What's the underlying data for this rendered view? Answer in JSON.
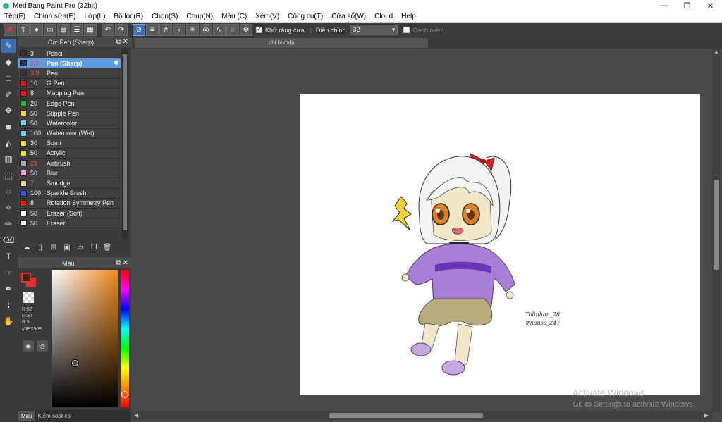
{
  "window": {
    "title": "MediBang Paint Pro (32bit)",
    "minimize": "—",
    "maximize": "❐",
    "close": "✕"
  },
  "menu": [
    "Tệp(F)",
    "Chỉnh sửa(E)",
    "Lớp(L)",
    "Bộ lọc(R)",
    "Chọn(S)",
    "Chụp(N)",
    "Màu (C)",
    "Xem(V)",
    "Công cụ(T)",
    "Cửa sổ(W)",
    "Cloud",
    "Help"
  ],
  "toolbar": {
    "antialias_label": "Khử răng cưa",
    "adjust_label": "Điều chỉnh",
    "adjust_value": "32",
    "edge_label": "Cạnh mềm"
  },
  "brush_panel": {
    "title": "Cọ: Pen (Sharp)",
    "brushes": [
      {
        "size": "3",
        "name": "Pencil",
        "color": "#333333",
        "size_red": false
      },
      {
        "size": "2.7",
        "name": "Pen (Sharp)",
        "color": "#333333",
        "size_red": true,
        "selected": true
      },
      {
        "size": "3.9",
        "name": "Pen",
        "color": "#333333",
        "size_red": true
      },
      {
        "size": "10",
        "name": "G Pen",
        "color": "#e02020",
        "size_red": false
      },
      {
        "size": "8",
        "name": "Mapping Pen",
        "color": "#e02020",
        "size_red": false
      },
      {
        "size": "20",
        "name": "Edge Pen",
        "color": "#2ab52a",
        "size_red": false
      },
      {
        "size": "50",
        "name": "Stipple Pen",
        "color": "#f0e020",
        "size_red": false
      },
      {
        "size": "50",
        "name": "Watercolor",
        "color": "#80d0f0",
        "size_red": false
      },
      {
        "size": "100",
        "name": "Watercolor (Wet)",
        "color": "#80d0f0",
        "size_red": false
      },
      {
        "size": "30",
        "name": "Sumi",
        "color": "#f0e020",
        "size_red": false
      },
      {
        "size": "50",
        "name": "Acrylic",
        "color": "#f0e020",
        "size_red": false
      },
      {
        "size": "29",
        "name": "Airbrush",
        "color": "#aaaaaa",
        "size_red": true
      },
      {
        "size": "50",
        "name": "Blur",
        "color": "#f0a0e0",
        "size_red": false
      },
      {
        "size": "7",
        "name": "Smudge",
        "color": "#f0d0b0",
        "size_red": true
      },
      {
        "size": "100",
        "name": "Sparkle Brush",
        "color": "#3050e0",
        "size_red": false
      },
      {
        "size": "8",
        "name": "Rotation Symmetry Pen",
        "color": "#e02020",
        "size_red": false
      },
      {
        "size": "50",
        "name": "Eraser (Soft)",
        "color": "#ffffff",
        "size_red": false
      },
      {
        "size": "50",
        "name": "Eraser",
        "color": "#ffffff",
        "size_red": false
      }
    ]
  },
  "color_panel": {
    "title": "Màu",
    "r": "R:62",
    "g": "G:37",
    "b": "B:8",
    "hex": "#3E2508",
    "foreground": "#3E2508",
    "background": "#dd3333"
  },
  "bottom_tabs": [
    "Màu",
    "Kiểm soát cọ"
  ],
  "document": {
    "tab_name": "chi bi.mdp",
    "signature_line1": "Tolinhan_28",
    "signature_line2": "#nauss_247"
  },
  "watermark": {
    "line1": "Activate Windows",
    "line2": "Go to Settings to activate Windows."
  }
}
